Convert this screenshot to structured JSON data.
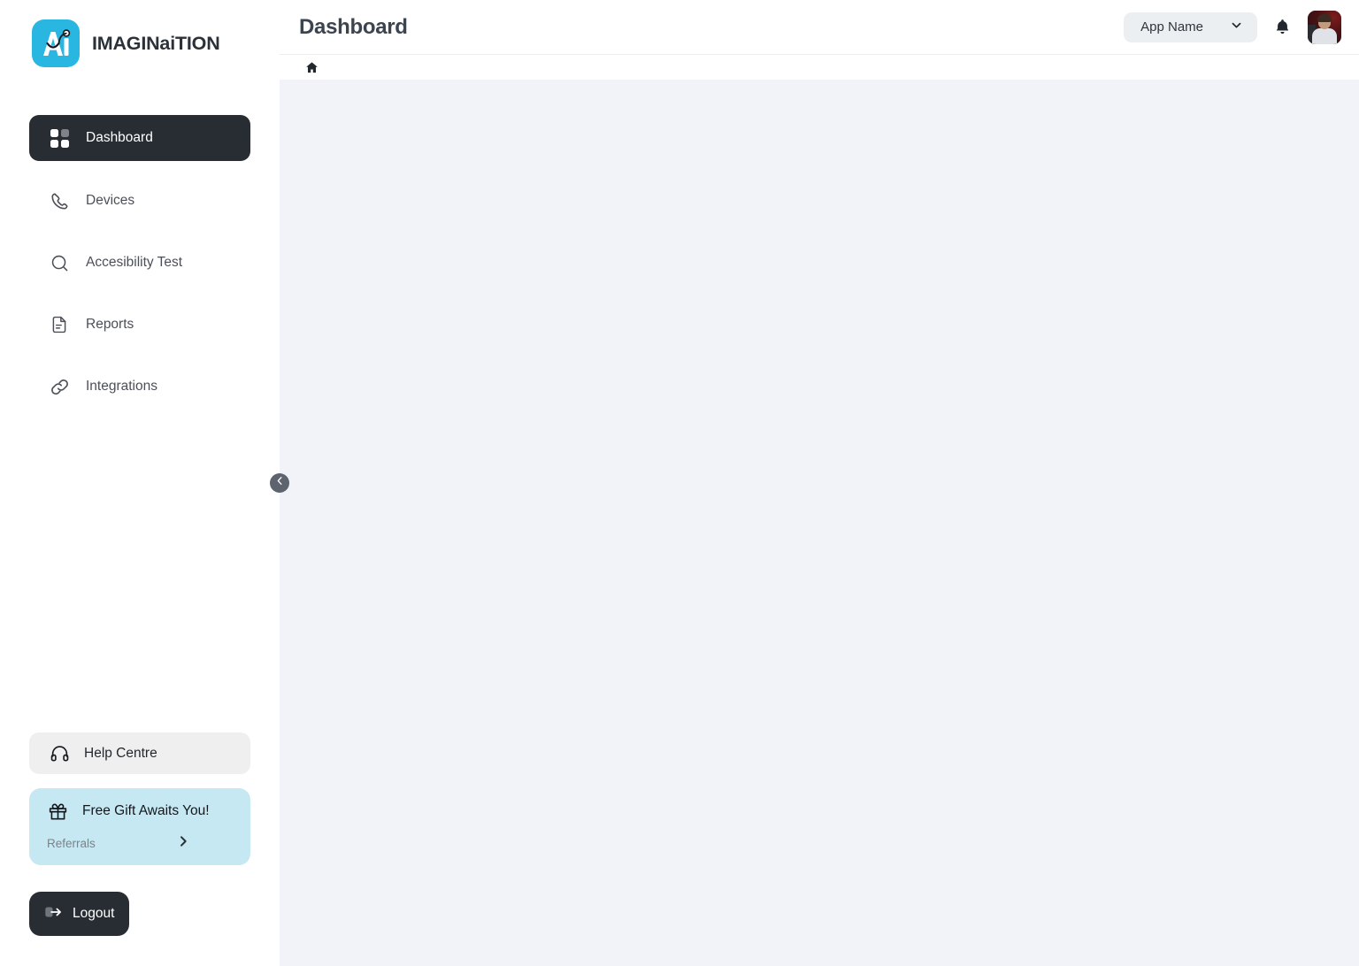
{
  "brand": {
    "name": "IMAGINaiTION",
    "logo_icon": "ai-logo-icon",
    "logo_color": "#29b6e0"
  },
  "sidebar": {
    "items": [
      {
        "label": "Dashboard",
        "icon": "grid-icon",
        "active": true
      },
      {
        "label": "Devices",
        "icon": "phone-icon",
        "active": false
      },
      {
        "label": "Accesibility Test",
        "icon": "search-icon",
        "active": false
      },
      {
        "label": "Reports",
        "icon": "document-icon",
        "active": false
      },
      {
        "label": "Integrations",
        "icon": "link-icon",
        "active": false
      }
    ],
    "help": {
      "label": "Help Centre",
      "icon": "headphones-icon"
    },
    "gift": {
      "title": "Free Gift Awaits You!",
      "subtitle": "Referrals",
      "icon": "gift-icon",
      "chevron_icon": "chevron-right-icon",
      "background": "#c6e8f3"
    },
    "logout": {
      "label": "Logout",
      "icon": "logout-icon"
    },
    "collapse": {
      "icon": "chevron-left-icon"
    }
  },
  "header": {
    "title": "Dashboard",
    "app_select": {
      "value": "App Name",
      "chevron_icon": "chevron-down-icon"
    },
    "notification_icon": "bell-icon",
    "avatar_icon": "user-avatar"
  },
  "breadcrumb": {
    "home_icon": "home-icon"
  }
}
